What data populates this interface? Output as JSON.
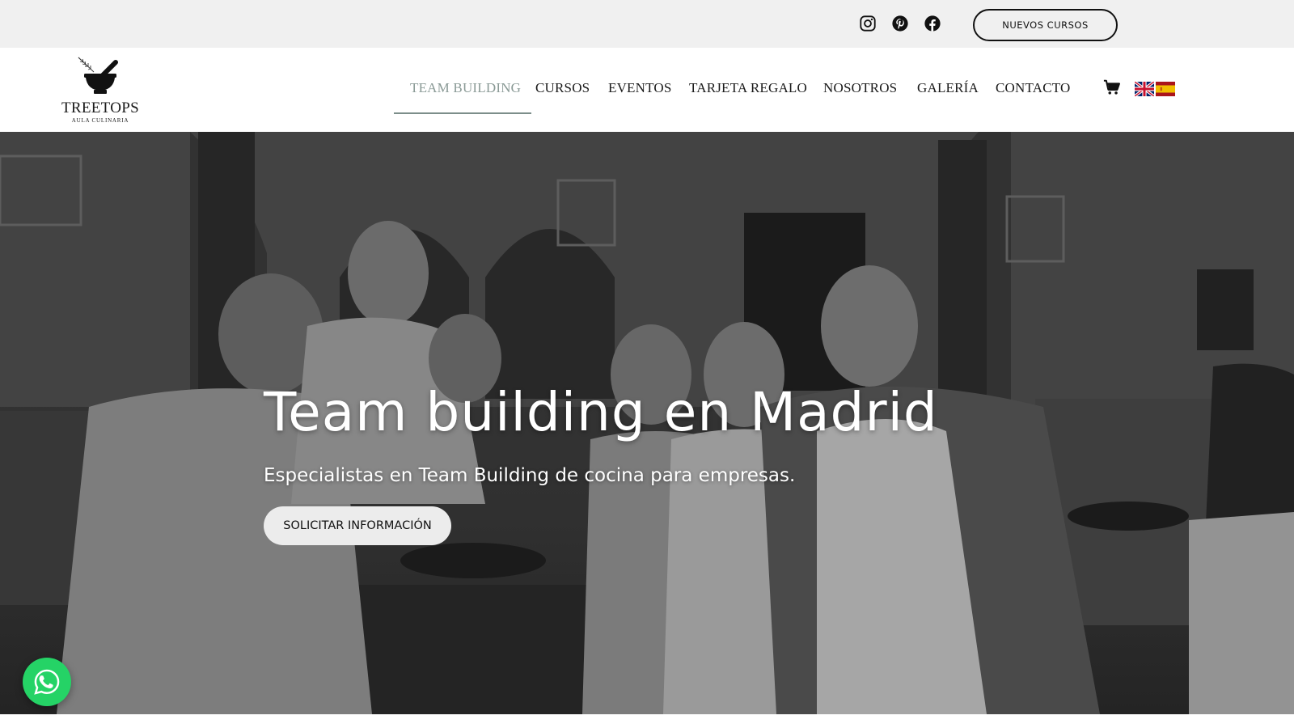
{
  "topbar": {
    "social": [
      {
        "icon": "instagram-icon",
        "label": "Instagram"
      },
      {
        "icon": "pinterest-icon",
        "label": "Pinterest"
      },
      {
        "icon": "facebook-icon",
        "label": "Facebook"
      }
    ],
    "cta_label": "NUEVOS CURSOS"
  },
  "header": {
    "logo": {
      "name": "TREETOPS",
      "subtitle": "AULA CULINARIA",
      "icon": "mortar-and-pestle-icon"
    },
    "nav": [
      {
        "label": "TEAM BUILDING",
        "active": true
      },
      {
        "label": "CURSOS",
        "active": false
      },
      {
        "label": "EVENTOS",
        "active": false
      },
      {
        "label": "TARJETA REGALO",
        "active": false
      },
      {
        "label": "NOSOTROS",
        "active": false
      },
      {
        "label": "GALERÍA",
        "active": false
      },
      {
        "label": "CONTACTO",
        "active": false
      }
    ],
    "cart_icon": "cart-icon",
    "languages": [
      {
        "icon": "flag-uk-icon",
        "code": "EN"
      },
      {
        "icon": "flag-es-icon",
        "code": "ES"
      }
    ]
  },
  "hero": {
    "title": "Team building en Madrid",
    "subtitle": "Especialistas en Team Building de cocina para empresas.",
    "cta_label": "SOLICITAR INFORMACIÓN"
  },
  "whatsapp": {
    "icon": "whatsapp-icon"
  },
  "colors": {
    "topbar_bg": "#f0f0f0",
    "nav_active": "#8a9a96",
    "nav_underline": "#7c8e8a",
    "whatsapp": "#25d366",
    "hero_text": "#ffffff"
  }
}
